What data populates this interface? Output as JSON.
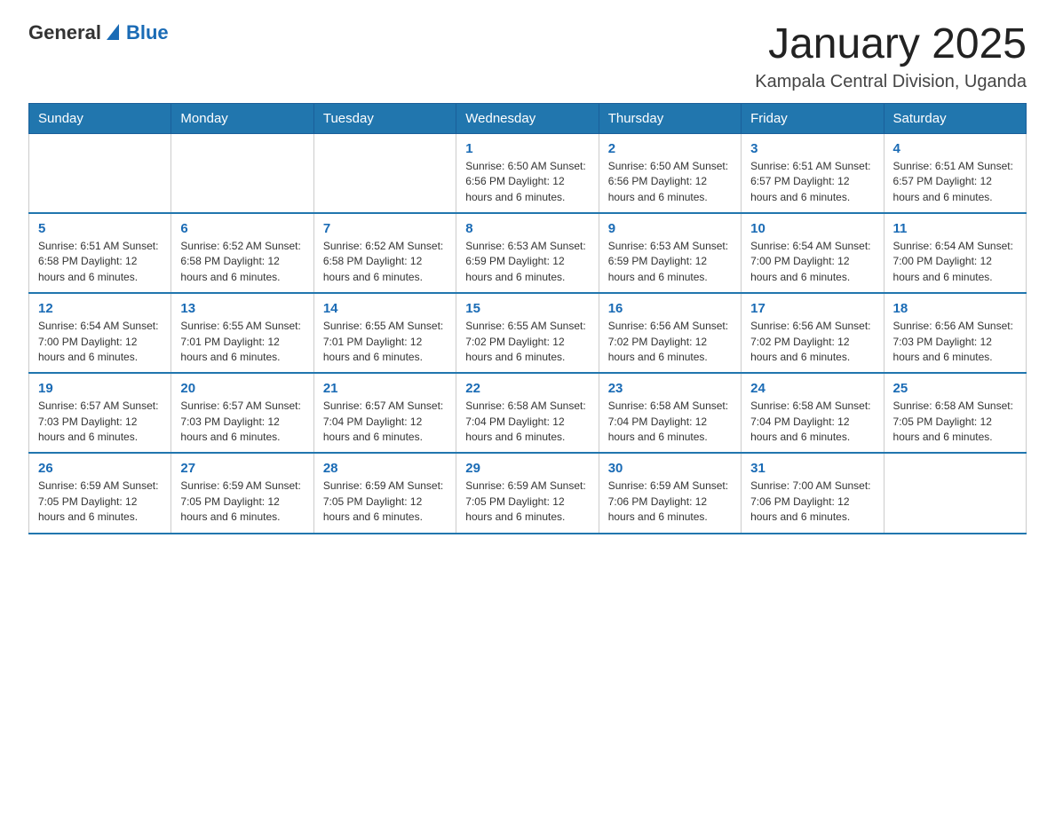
{
  "header": {
    "logo_general": "General",
    "logo_blue": "Blue",
    "month_title": "January 2025",
    "location": "Kampala Central Division, Uganda"
  },
  "days_of_week": [
    "Sunday",
    "Monday",
    "Tuesday",
    "Wednesday",
    "Thursday",
    "Friday",
    "Saturday"
  ],
  "weeks": [
    {
      "days": [
        {
          "number": "",
          "info": ""
        },
        {
          "number": "",
          "info": ""
        },
        {
          "number": "",
          "info": ""
        },
        {
          "number": "1",
          "info": "Sunrise: 6:50 AM\nSunset: 6:56 PM\nDaylight: 12 hours and 6 minutes."
        },
        {
          "number": "2",
          "info": "Sunrise: 6:50 AM\nSunset: 6:56 PM\nDaylight: 12 hours and 6 minutes."
        },
        {
          "number": "3",
          "info": "Sunrise: 6:51 AM\nSunset: 6:57 PM\nDaylight: 12 hours and 6 minutes."
        },
        {
          "number": "4",
          "info": "Sunrise: 6:51 AM\nSunset: 6:57 PM\nDaylight: 12 hours and 6 minutes."
        }
      ]
    },
    {
      "days": [
        {
          "number": "5",
          "info": "Sunrise: 6:51 AM\nSunset: 6:58 PM\nDaylight: 12 hours and 6 minutes."
        },
        {
          "number": "6",
          "info": "Sunrise: 6:52 AM\nSunset: 6:58 PM\nDaylight: 12 hours and 6 minutes."
        },
        {
          "number": "7",
          "info": "Sunrise: 6:52 AM\nSunset: 6:58 PM\nDaylight: 12 hours and 6 minutes."
        },
        {
          "number": "8",
          "info": "Sunrise: 6:53 AM\nSunset: 6:59 PM\nDaylight: 12 hours and 6 minutes."
        },
        {
          "number": "9",
          "info": "Sunrise: 6:53 AM\nSunset: 6:59 PM\nDaylight: 12 hours and 6 minutes."
        },
        {
          "number": "10",
          "info": "Sunrise: 6:54 AM\nSunset: 7:00 PM\nDaylight: 12 hours and 6 minutes."
        },
        {
          "number": "11",
          "info": "Sunrise: 6:54 AM\nSunset: 7:00 PM\nDaylight: 12 hours and 6 minutes."
        }
      ]
    },
    {
      "days": [
        {
          "number": "12",
          "info": "Sunrise: 6:54 AM\nSunset: 7:00 PM\nDaylight: 12 hours and 6 minutes."
        },
        {
          "number": "13",
          "info": "Sunrise: 6:55 AM\nSunset: 7:01 PM\nDaylight: 12 hours and 6 minutes."
        },
        {
          "number": "14",
          "info": "Sunrise: 6:55 AM\nSunset: 7:01 PM\nDaylight: 12 hours and 6 minutes."
        },
        {
          "number": "15",
          "info": "Sunrise: 6:55 AM\nSunset: 7:02 PM\nDaylight: 12 hours and 6 minutes."
        },
        {
          "number": "16",
          "info": "Sunrise: 6:56 AM\nSunset: 7:02 PM\nDaylight: 12 hours and 6 minutes."
        },
        {
          "number": "17",
          "info": "Sunrise: 6:56 AM\nSunset: 7:02 PM\nDaylight: 12 hours and 6 minutes."
        },
        {
          "number": "18",
          "info": "Sunrise: 6:56 AM\nSunset: 7:03 PM\nDaylight: 12 hours and 6 minutes."
        }
      ]
    },
    {
      "days": [
        {
          "number": "19",
          "info": "Sunrise: 6:57 AM\nSunset: 7:03 PM\nDaylight: 12 hours and 6 minutes."
        },
        {
          "number": "20",
          "info": "Sunrise: 6:57 AM\nSunset: 7:03 PM\nDaylight: 12 hours and 6 minutes."
        },
        {
          "number": "21",
          "info": "Sunrise: 6:57 AM\nSunset: 7:04 PM\nDaylight: 12 hours and 6 minutes."
        },
        {
          "number": "22",
          "info": "Sunrise: 6:58 AM\nSunset: 7:04 PM\nDaylight: 12 hours and 6 minutes."
        },
        {
          "number": "23",
          "info": "Sunrise: 6:58 AM\nSunset: 7:04 PM\nDaylight: 12 hours and 6 minutes."
        },
        {
          "number": "24",
          "info": "Sunrise: 6:58 AM\nSunset: 7:04 PM\nDaylight: 12 hours and 6 minutes."
        },
        {
          "number": "25",
          "info": "Sunrise: 6:58 AM\nSunset: 7:05 PM\nDaylight: 12 hours and 6 minutes."
        }
      ]
    },
    {
      "days": [
        {
          "number": "26",
          "info": "Sunrise: 6:59 AM\nSunset: 7:05 PM\nDaylight: 12 hours and 6 minutes."
        },
        {
          "number": "27",
          "info": "Sunrise: 6:59 AM\nSunset: 7:05 PM\nDaylight: 12 hours and 6 minutes."
        },
        {
          "number": "28",
          "info": "Sunrise: 6:59 AM\nSunset: 7:05 PM\nDaylight: 12 hours and 6 minutes."
        },
        {
          "number": "29",
          "info": "Sunrise: 6:59 AM\nSunset: 7:05 PM\nDaylight: 12 hours and 6 minutes."
        },
        {
          "number": "30",
          "info": "Sunrise: 6:59 AM\nSunset: 7:06 PM\nDaylight: 12 hours and 6 minutes."
        },
        {
          "number": "31",
          "info": "Sunrise: 7:00 AM\nSunset: 7:06 PM\nDaylight: 12 hours and 6 minutes."
        },
        {
          "number": "",
          "info": ""
        }
      ]
    }
  ]
}
